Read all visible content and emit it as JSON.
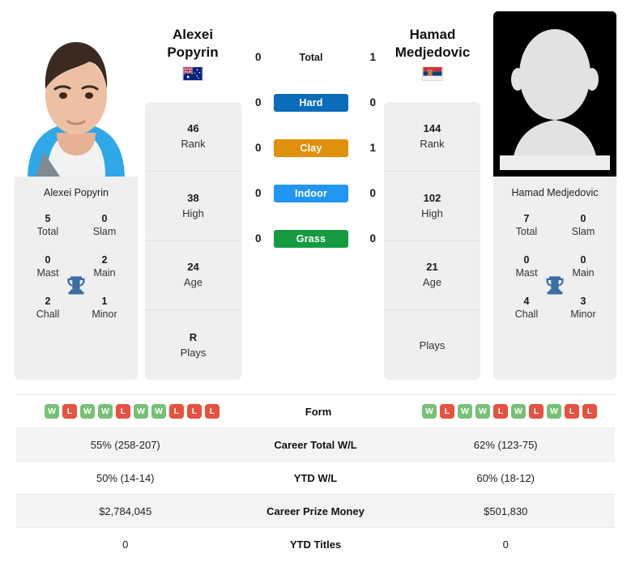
{
  "players": {
    "left": {
      "first_name": "Alexei",
      "last_name": "Popyrin",
      "full_name": "Alexei Popyrin",
      "flag": "australia-flag",
      "rank": "46",
      "rank_label": "Rank",
      "high": "38",
      "high_label": "High",
      "age": "24",
      "age_label": "Age",
      "plays": "R",
      "plays_label": "Plays",
      "titles": {
        "total": "5",
        "total_label": "Total",
        "slam": "0",
        "slam_label": "Slam",
        "mast": "0",
        "mast_label": "Mast",
        "main": "2",
        "main_label": "Main",
        "chall": "2",
        "chall_label": "Chall",
        "minor": "1",
        "minor_label": "Minor"
      },
      "form": [
        "W",
        "L",
        "W",
        "W",
        "L",
        "W",
        "W",
        "L",
        "L",
        "L"
      ],
      "career_total_wl": "55% (258-207)",
      "ytd_wl": "50% (14-14)",
      "career_prize_money": "$2,784,045",
      "ytd_titles": "0"
    },
    "right": {
      "first_name": "Hamad",
      "last_name": "Medjedovic",
      "full_name": "Hamad Medjedovic",
      "flag": "serbia-flag",
      "rank": "144",
      "rank_label": "Rank",
      "high": "102",
      "high_label": "High",
      "age": "21",
      "age_label": "Age",
      "plays": "",
      "plays_label": "Plays",
      "titles": {
        "total": "7",
        "total_label": "Total",
        "slam": "0",
        "slam_label": "Slam",
        "mast": "0",
        "mast_label": "Mast",
        "main": "0",
        "main_label": "Main",
        "chall": "4",
        "chall_label": "Chall",
        "minor": "3",
        "minor_label": "Minor"
      },
      "form": [
        "W",
        "L",
        "W",
        "W",
        "L",
        "W",
        "L",
        "W",
        "L",
        "L"
      ],
      "career_total_wl": "62% (123-75)",
      "ytd_wl": "60% (18-12)",
      "career_prize_money": "$501,830",
      "ytd_titles": "0"
    }
  },
  "h2h": {
    "rows": [
      {
        "label": "Total",
        "left": "0",
        "right": "1",
        "style": "plain",
        "color": ""
      },
      {
        "label": "Hard",
        "left": "0",
        "right": "0",
        "style": "pill",
        "color": "#0b6cba"
      },
      {
        "label": "Clay",
        "left": "0",
        "right": "1",
        "style": "pill",
        "color": "#e0900d"
      },
      {
        "label": "Indoor",
        "left": "0",
        "right": "0",
        "style": "pill",
        "color": "#2196f3"
      },
      {
        "label": "Grass",
        "left": "0",
        "right": "0",
        "style": "pill",
        "color": "#149b40"
      }
    ]
  },
  "table": {
    "rows": [
      {
        "label": "Form",
        "type": "form"
      },
      {
        "label": "Career Total W/L",
        "type": "text",
        "key": "career_total_wl"
      },
      {
        "label": "YTD W/L",
        "type": "text",
        "key": "ytd_wl"
      },
      {
        "label": "Career Prize Money",
        "type": "text",
        "key": "career_prize_money"
      },
      {
        "label": "YTD Titles",
        "type": "text",
        "key": "ytd_titles"
      }
    ]
  },
  "colors": {
    "win_badge": "#77c176",
    "loss_badge": "#e8513f",
    "trophy": "#3a6ea5",
    "card_bg": "#efefef",
    "row_alt": "#f4f4f4"
  }
}
